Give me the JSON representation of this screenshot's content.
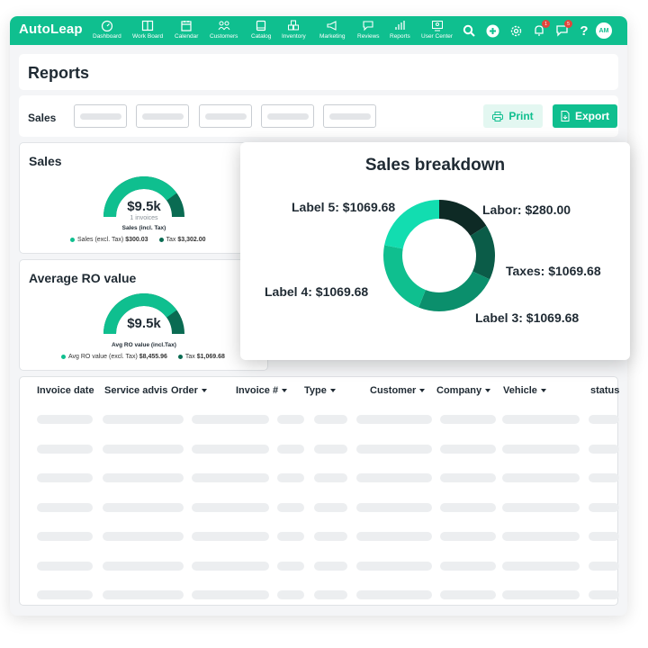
{
  "app": {
    "logo": "AutoLeap"
  },
  "nav": [
    {
      "label": "Dashboard",
      "icon": "dashboard-icon"
    },
    {
      "label": "Work Board",
      "icon": "work-board-icon"
    },
    {
      "label": "Calendar",
      "icon": "calendar-icon"
    },
    {
      "label": "Customers",
      "icon": "customers-icon"
    },
    {
      "label": "Catalog",
      "icon": "catalog-icon"
    },
    {
      "label": "Inventory",
      "icon": "inventory-icon"
    },
    {
      "label": "Marketing",
      "icon": "marketing-icon"
    },
    {
      "label": "Reviews",
      "icon": "reviews-icon"
    },
    {
      "label": "Reports",
      "icon": "reports-icon"
    },
    {
      "label": "User Center",
      "icon": "user-center-icon"
    }
  ],
  "topbar": {
    "notifications_count": "1",
    "messages_count": "5",
    "avatar_initials": "AM"
  },
  "page": {
    "title": "Reports"
  },
  "filters": {
    "label": "Sales",
    "print_label": "Print",
    "export_label": "Export"
  },
  "sales_card": {
    "title": "Sales",
    "value": "$9.5k",
    "sub": "1 invoices",
    "caption": "Sales (incl. Tax)",
    "legend": [
      {
        "label": "Sales (excl. Tax)",
        "value": "$300.03",
        "color": "#0fbf8f"
      },
      {
        "label": "Tax",
        "value": "$3,302.00",
        "color": "#0a6b52"
      }
    ],
    "fill_fraction": 0.8
  },
  "ro_card": {
    "title": "Average RO value",
    "value": "$9.5k",
    "caption": "Avg RO value (incl.Tax)",
    "legend": [
      {
        "label": "Avg RO value (excl. Tax)",
        "value": "$8,455.96",
        "color": "#0fbf8f"
      },
      {
        "label": "Tax",
        "value": "$1,069.68",
        "color": "#0a6b52"
      }
    ],
    "fill_fraction": 0.8
  },
  "breakdown": {
    "title": "Sales breakdown",
    "slices": [
      {
        "label": "Labor: $280.00",
        "value": 0.16,
        "color": "#0e2a25"
      },
      {
        "label": "Taxes: $1069.68",
        "value": 0.16,
        "color": "#0b5c48"
      },
      {
        "label": "Label 3: $1069.68",
        "value": 0.24,
        "color": "#0b8f6c"
      },
      {
        "label": "Label 4: $1069.68",
        "value": 0.22,
        "color": "#0fbf8f"
      },
      {
        "label": "Label 5: $1069.68",
        "value": 0.22,
        "color": "#12ddb0"
      }
    ]
  },
  "table": {
    "columns": [
      {
        "label": "Invoice date",
        "sortable": false
      },
      {
        "label": "Service advis",
        "sortable": false
      },
      {
        "label": "Order",
        "sortable": true
      },
      {
        "label": "Invoice #",
        "sortable": true
      },
      {
        "label": "Type",
        "sortable": true
      },
      {
        "label": "Customer",
        "sortable": true
      },
      {
        "label": "Company",
        "sortable": true
      },
      {
        "label": "Vehicle",
        "sortable": true
      },
      {
        "label": "status",
        "sortable": false
      }
    ],
    "placeholder_rows": 7
  }
}
